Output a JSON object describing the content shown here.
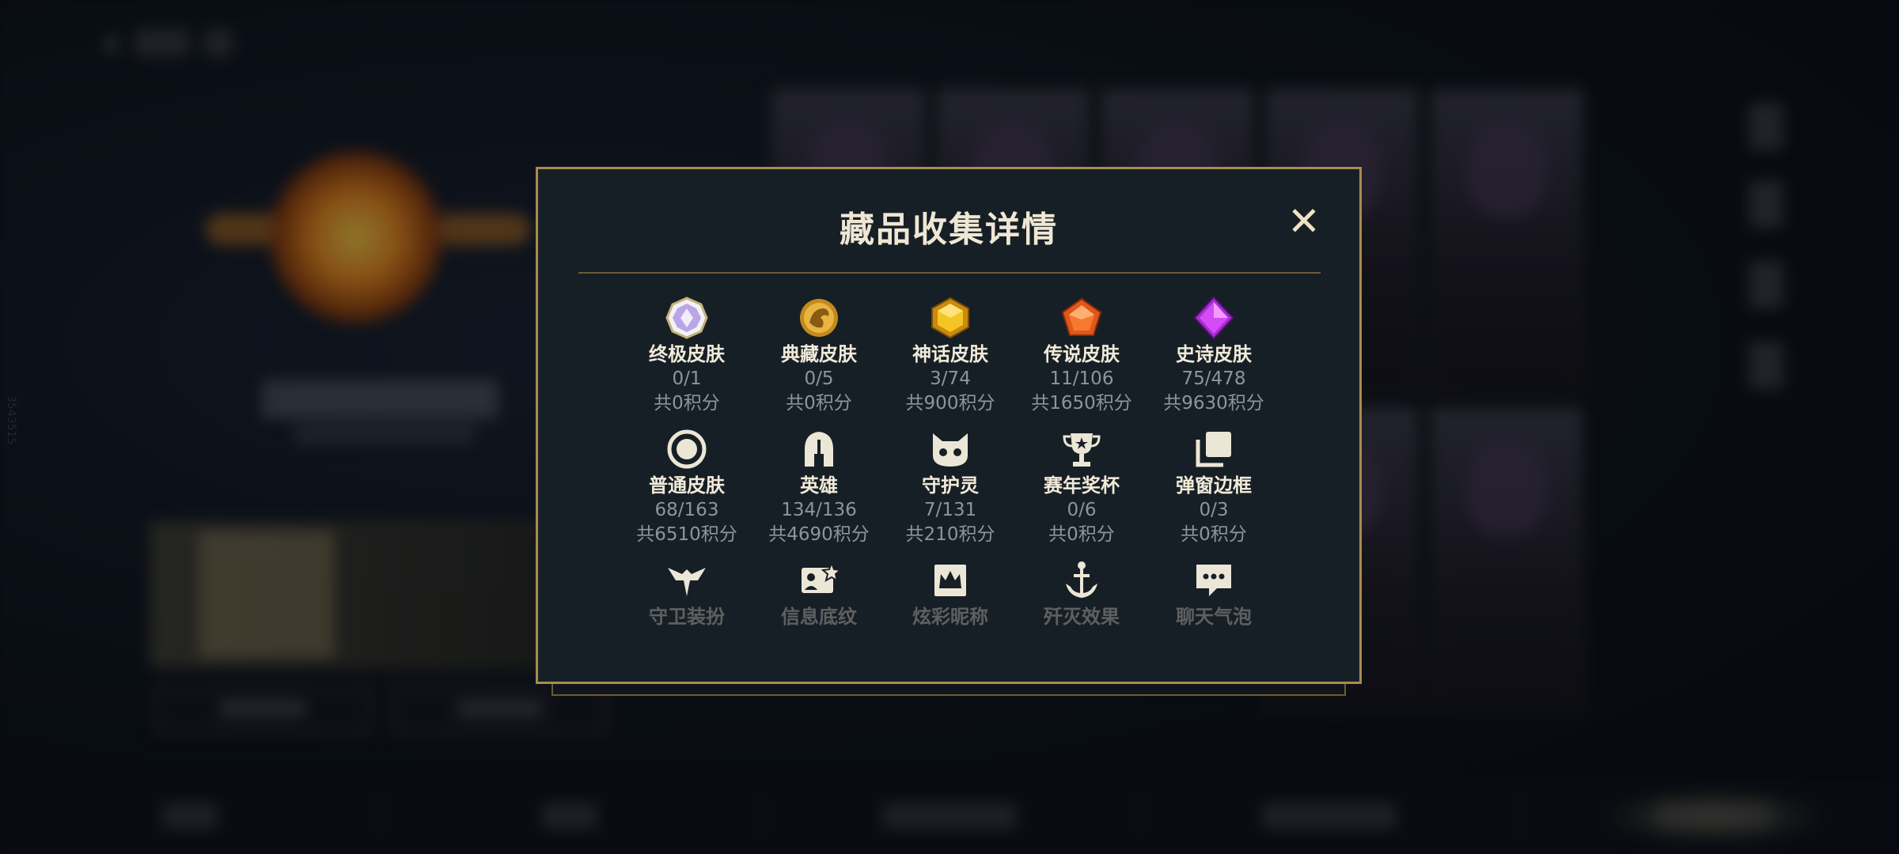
{
  "background": {
    "side_id": "3543515"
  },
  "modal": {
    "title": "藏品收集详情",
    "close_label": "✕",
    "items": [
      {
        "name": "终极皮肤",
        "count": "0/1",
        "points": "共0积分",
        "icon": "ultimate-skin-icon"
      },
      {
        "name": "典藏皮肤",
        "count": "0/5",
        "points": "共0积分",
        "icon": "collector-skin-icon"
      },
      {
        "name": "神话皮肤",
        "count": "3/74",
        "points": "共900积分",
        "icon": "mythic-skin-icon"
      },
      {
        "name": "传说皮肤",
        "count": "11/106",
        "points": "共1650积分",
        "icon": "legendary-skin-icon"
      },
      {
        "name": "史诗皮肤",
        "count": "75/478",
        "points": "共9630积分",
        "icon": "epic-skin-icon"
      },
      {
        "name": "普通皮肤",
        "count": "68/163",
        "points": "共6510积分",
        "icon": "standard-skin-icon"
      },
      {
        "name": "英雄",
        "count": "134/136",
        "points": "共4690积分",
        "icon": "champion-helmet-icon"
      },
      {
        "name": "守护灵",
        "count": "7/131",
        "points": "共210积分",
        "icon": "little-legend-icon"
      },
      {
        "name": "赛年奖杯",
        "count": "0/6",
        "points": "共0积分",
        "icon": "trophy-icon"
      },
      {
        "name": "弹窗边框",
        "count": "0/3",
        "points": "共0积分",
        "icon": "popup-frame-icon"
      },
      {
        "name": "守卫装扮",
        "icon": "ward-skin-icon"
      },
      {
        "name": "信息底纹",
        "icon": "info-card-icon"
      },
      {
        "name": "炫彩昵称",
        "icon": "crown-name-icon"
      },
      {
        "name": "歼灭效果",
        "icon": "anchor-icon"
      },
      {
        "name": "聊天气泡",
        "icon": "chat-bubble-icon"
      }
    ]
  },
  "colors": {
    "modal_bg": "#171f26",
    "modal_border": "#a88c4e",
    "title_text": "#efe7d4",
    "muted_text": "#8f949a"
  }
}
